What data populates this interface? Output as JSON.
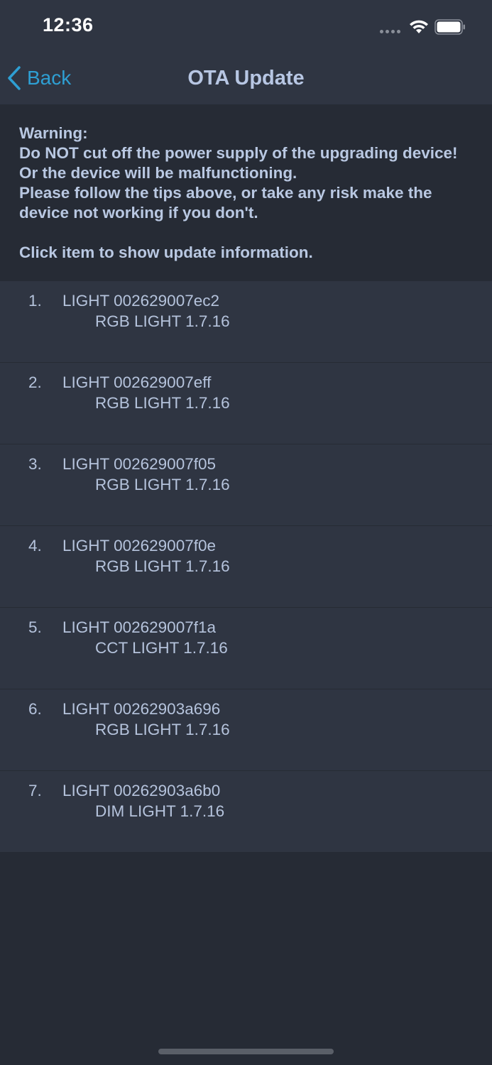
{
  "status_bar": {
    "time": "12:36"
  },
  "nav": {
    "back_label": "Back",
    "title": "OTA Update"
  },
  "warning": {
    "text": "Warning:\nDo NOT cut off the power supply of the upgrading device! Or the device will be malfunctioning.\nPlease follow the tips above, or take any risk make the device not working if you don't.",
    "hint": "Click item to show update information."
  },
  "devices": [
    {
      "index": "1.",
      "name": "LIGHT 002629007ec2",
      "detail": "RGB LIGHT  1.7.16"
    },
    {
      "index": "2.",
      "name": "LIGHT 002629007eff",
      "detail": "RGB LIGHT  1.7.16"
    },
    {
      "index": "3.",
      "name": "LIGHT 002629007f05",
      "detail": "RGB LIGHT  1.7.16"
    },
    {
      "index": "4.",
      "name": "LIGHT 002629007f0e",
      "detail": "RGB LIGHT  1.7.16"
    },
    {
      "index": "5.",
      "name": "LIGHT 002629007f1a",
      "detail": "CCT LIGHT  1.7.16"
    },
    {
      "index": "6.",
      "name": "LIGHT 00262903a696",
      "detail": "RGB LIGHT  1.7.16"
    },
    {
      "index": "7.",
      "name": "LIGHT 00262903a6b0",
      "detail": "DIM LIGHT  1.7.16"
    }
  ],
  "colors": {
    "accent": "#2e9fd3",
    "title_text": "#b7c6e3",
    "body_text": "#b5c3dc",
    "header_bg": "#2f3542",
    "page_bg": "#262b35"
  },
  "icons": {
    "back": "chevron-left-icon",
    "wifi": "wifi-icon",
    "battery": "battery-icon",
    "signal": "cellular-signal-icon"
  }
}
